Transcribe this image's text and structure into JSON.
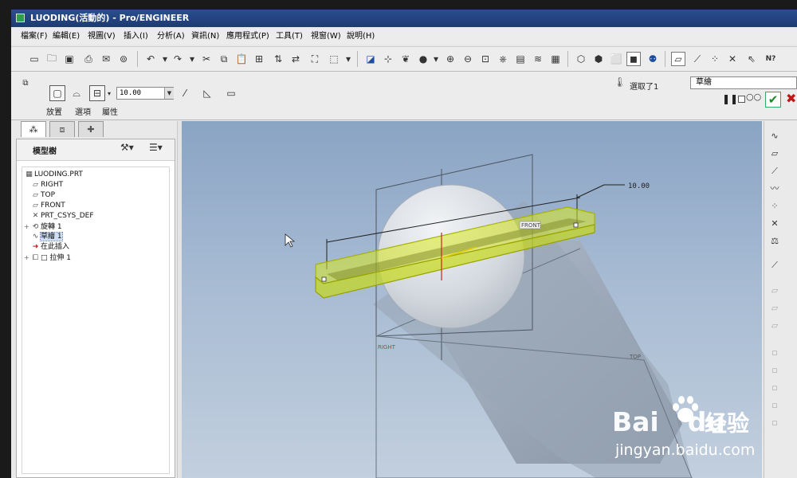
{
  "window": {
    "title": "LUODING(活動的) - Pro/ENGINEER"
  },
  "menu": [
    "檔案(F)",
    "編輯(E)",
    "視圖(V)",
    "插入(I)",
    "分析(A)",
    "資訊(N)",
    "應用程式(P)",
    "工具(T)",
    "視窗(W)",
    "說明(H)"
  ],
  "toolbar": {
    "help_label": "N?"
  },
  "dashboard": {
    "depth_value": "10.00",
    "tabs": [
      "放置",
      "選項",
      "屬性"
    ],
    "selected_count": "選取了1",
    "selected_item": "草繪"
  },
  "model_tree": {
    "header": "模型樹",
    "items": [
      {
        "label": "LUODING.PRT",
        "icon": "part-icon",
        "indent": 0,
        "expander": ""
      },
      {
        "label": "RIGHT",
        "icon": "datum-plane-icon",
        "indent": 1,
        "expander": ""
      },
      {
        "label": "TOP",
        "icon": "datum-plane-icon",
        "indent": 1,
        "expander": ""
      },
      {
        "label": "FRONT",
        "icon": "datum-plane-icon",
        "indent": 1,
        "expander": ""
      },
      {
        "label": "PRT_CSYS_DEF",
        "icon": "csys-icon",
        "indent": 1,
        "expander": ""
      },
      {
        "label": "旋轉 1",
        "icon": "revolve-icon",
        "indent": 1,
        "expander": "+"
      },
      {
        "label": "草繪 1",
        "icon": "sketch-icon",
        "indent": 1,
        "expander": "",
        "selected": true
      },
      {
        "label": "在此插入",
        "icon": "insert-here-icon",
        "indent": 1,
        "expander": ""
      },
      {
        "label": "□ 拉伸 1",
        "icon": "extrude-icon",
        "indent": 1,
        "expander": "+"
      }
    ]
  },
  "viewport": {
    "dimension_label": "10.00",
    "datum_front": "FRONT",
    "datum_right": "RIGHT",
    "datum_top": "TOP"
  },
  "watermark": {
    "logo_left": "Bai",
    "logo_right": "du",
    "brand": "经验",
    "url": "jingyan.baidu.com"
  },
  "colors": {
    "selection_yellow": "#d8e820",
    "titlebar_blue": "#2b4e8f",
    "ok_green": "#1b8a2a",
    "cancel_red": "#c01818"
  }
}
